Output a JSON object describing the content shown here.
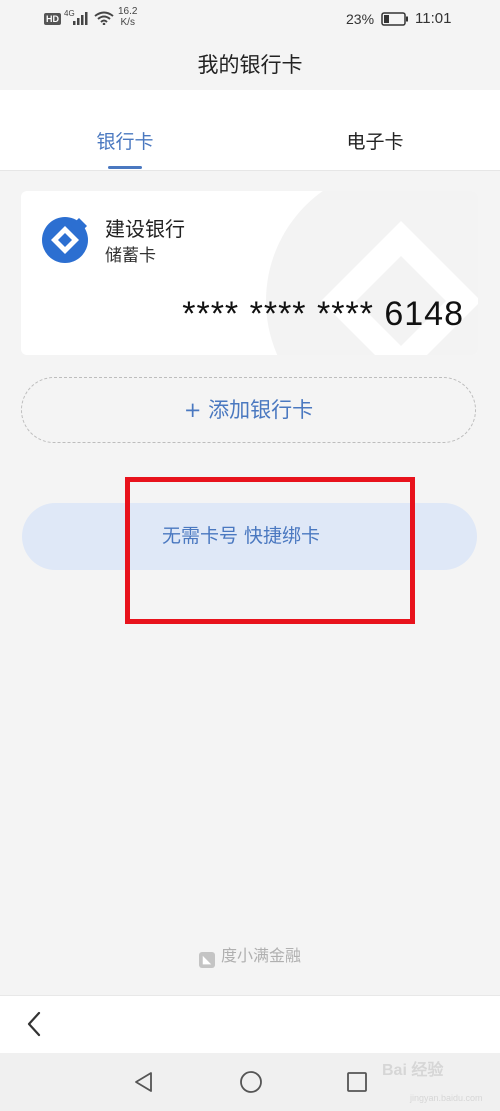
{
  "status_bar": {
    "hd": "HD",
    "network": "4G",
    "speed_value": "16.2",
    "speed_unit": "K/s",
    "battery_pct": "23%",
    "time": "11:01"
  },
  "page_title": "我的银行卡",
  "tabs": [
    {
      "label": "银行卡",
      "active": true
    },
    {
      "label": "电子卡",
      "active": false
    }
  ],
  "card": {
    "bank_name": "建设银行",
    "card_type": "储蓄卡",
    "card_number": "**** **** **** 6148",
    "logo_icon": "ccb-logo-icon"
  },
  "add_card_label": "+ 添加银行卡",
  "quick_bind_label": "无需卡号 快捷绑卡",
  "footer_brand": "度小满金融",
  "watermark": {
    "text": "Bai 经验",
    "sub": "jingyan.baidu.com"
  },
  "colors": {
    "accent": "#4a78c0",
    "highlight": "#e8121c",
    "quick_bind_bg": "#dfe8f7"
  }
}
